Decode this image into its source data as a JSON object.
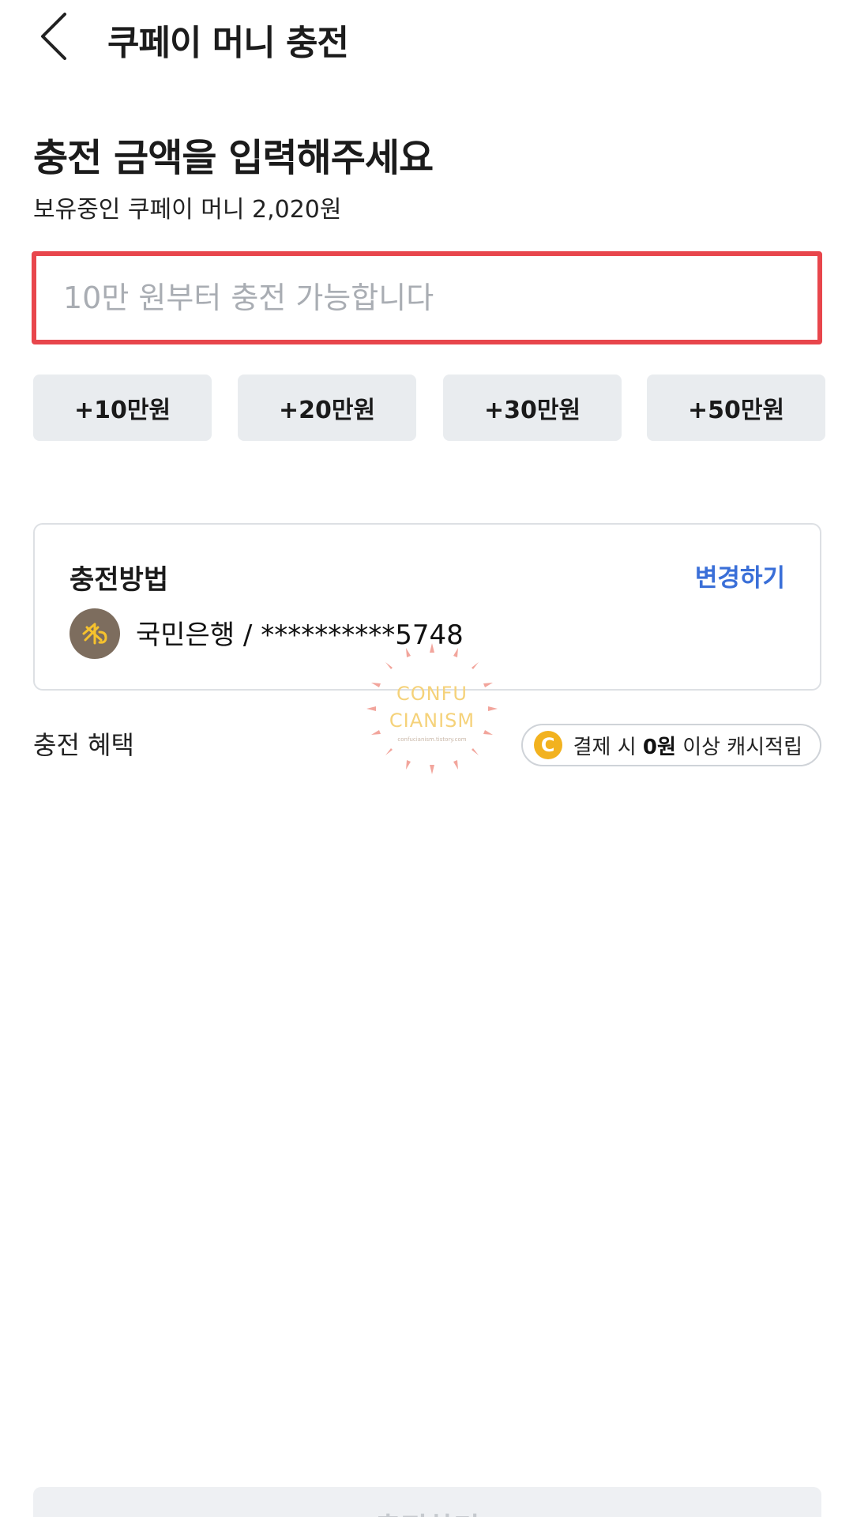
{
  "header": {
    "title": "쿠페이 머니 충전"
  },
  "main": {
    "title": "충전 금액을 입력해주세요",
    "balance_text": "보유중인 쿠페이 머니 2,020원",
    "amount_input": {
      "value": "",
      "placeholder": "10만 원부터 충전 가능합니다"
    },
    "quick_amounts": [
      "+10만원",
      "+20만원",
      "+30만원",
      "+50만원"
    ]
  },
  "method_card": {
    "label": "충전방법",
    "change_label": "변경하기",
    "bank_text": "국민은행 / **********5748",
    "bank_icon": "kb-bank-logo-icon"
  },
  "benefit": {
    "label": "충전 혜택",
    "icon_letter": "C",
    "text_prefix": "결제 시 ",
    "text_bold": "0원",
    "text_suffix": " 이상 캐시적립"
  },
  "watermark": {
    "line1": "CONFU",
    "line2": "CIANISM",
    "small": "confucianism.tistory.com"
  },
  "submit": {
    "label": "충전하기"
  },
  "colors": {
    "input_border": "#e8464c",
    "link": "#3a6fd8",
    "quick_button_bg": "#e9ecef",
    "cash_icon": "#f2b21f",
    "bank_logo_bg": "#7d6d5e"
  }
}
